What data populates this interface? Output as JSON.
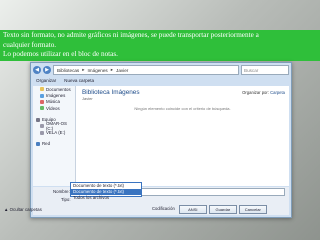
{
  "banner": {
    "line1": "Texto sin formato, no admite gráficos ni imágenes, se puede transportar posteriormente a",
    "line2": "cualquier formato.",
    "line3": "Lo podemos utilizar en el bloc de notas."
  },
  "dialog": {
    "address": {
      "crumbs": [
        "Bibliotecas",
        "Imágenes",
        "Javier"
      ],
      "search_placeholder": "Buscar"
    },
    "toolbar": {
      "organize": "Organizar",
      "new_folder": "Nueva carpeta"
    },
    "sidebar": {
      "items": [
        {
          "label": "Documentos",
          "icon": "documents-icon",
          "indent": true
        },
        {
          "label": "Imágenes",
          "icon": "images-icon",
          "indent": true
        },
        {
          "label": "Música",
          "icon": "music-icon",
          "indent": true
        },
        {
          "label": "Vídeos",
          "icon": "video-icon",
          "indent": true
        },
        {
          "label": "Equipo",
          "icon": "computer-icon",
          "indent": false
        },
        {
          "label": "OMAR-OS (C:)",
          "icon": "drive-icon",
          "indent": true
        },
        {
          "label": "VELA (E:)",
          "icon": "drive-icon",
          "indent": true
        },
        {
          "label": "Red",
          "icon": "network-icon",
          "indent": false
        }
      ]
    },
    "main": {
      "title": "Biblioteca Imágenes",
      "subtitle": "Javier",
      "organize_by": "Organizar por:",
      "organize_value": "Carpeta",
      "empty_text": "Ningún elemento coincide con el criterio de búsqueda."
    },
    "bottom": {
      "name_label": "Nombre:",
      "name_value": "Formato texto",
      "type_label": "Tipo:",
      "type_options": [
        "Documento de texto (*.txt)",
        "Documento de texto (*.txt)",
        "Todos los archivos"
      ],
      "hide_folders": "Ocultar carpetas",
      "encoding_label": "Codificación",
      "encoding_value": "ANSI",
      "save": "Guardar",
      "cancel": "Cancelar"
    }
  },
  "colors": {
    "banner": "#2fbf3a",
    "accent": "#3a74c0"
  }
}
